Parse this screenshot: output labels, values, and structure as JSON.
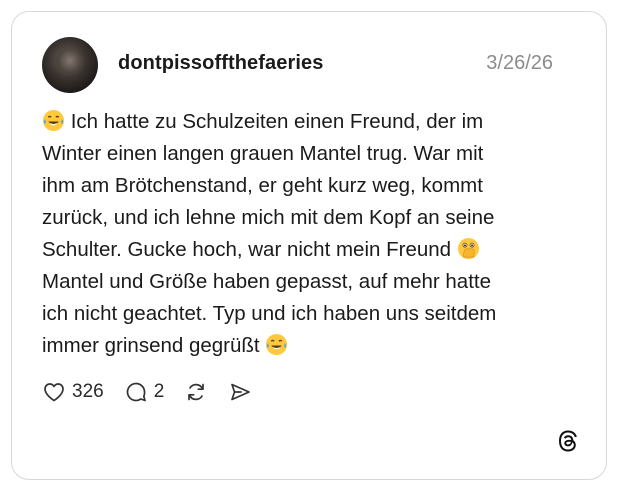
{
  "post": {
    "username": "dontpissoffthefaeries",
    "date": "3/26/26",
    "lines": [
      "Ich hatte zu Schulzeiten einen Freund, der im",
      "Winter einen langen grauen Mantel trug. War mit",
      "ihm am Brötchenstand, er geht kurz weg, kommt",
      "zurück, und ich lehne mich mit dem Kopf an seine",
      "Schulter. Gucke hoch, war nicht mein Freund",
      "Mantel und Größe haben gepasst, auf mehr hatte",
      "ich nicht geachtet. Typ und ich haben uns seitdem",
      "immer grinsend gegrüßt"
    ],
    "emojis": [
      "tears-of-joy-emoji",
      "face-with-open-eyes-and-hand-over-mouth-emoji",
      "tears-of-joy-emoji"
    ]
  },
  "actions": {
    "likes": "326",
    "replies": "2"
  },
  "icons": [
    "heart-icon",
    "reply-icon",
    "repost-icon",
    "share-icon",
    "threads-logo-icon"
  ],
  "colors": {
    "text": "#1b1b1b",
    "muted": "#8c8c8c",
    "border": "#d8d8d8",
    "emoji_yellow": "#FFC83D"
  }
}
